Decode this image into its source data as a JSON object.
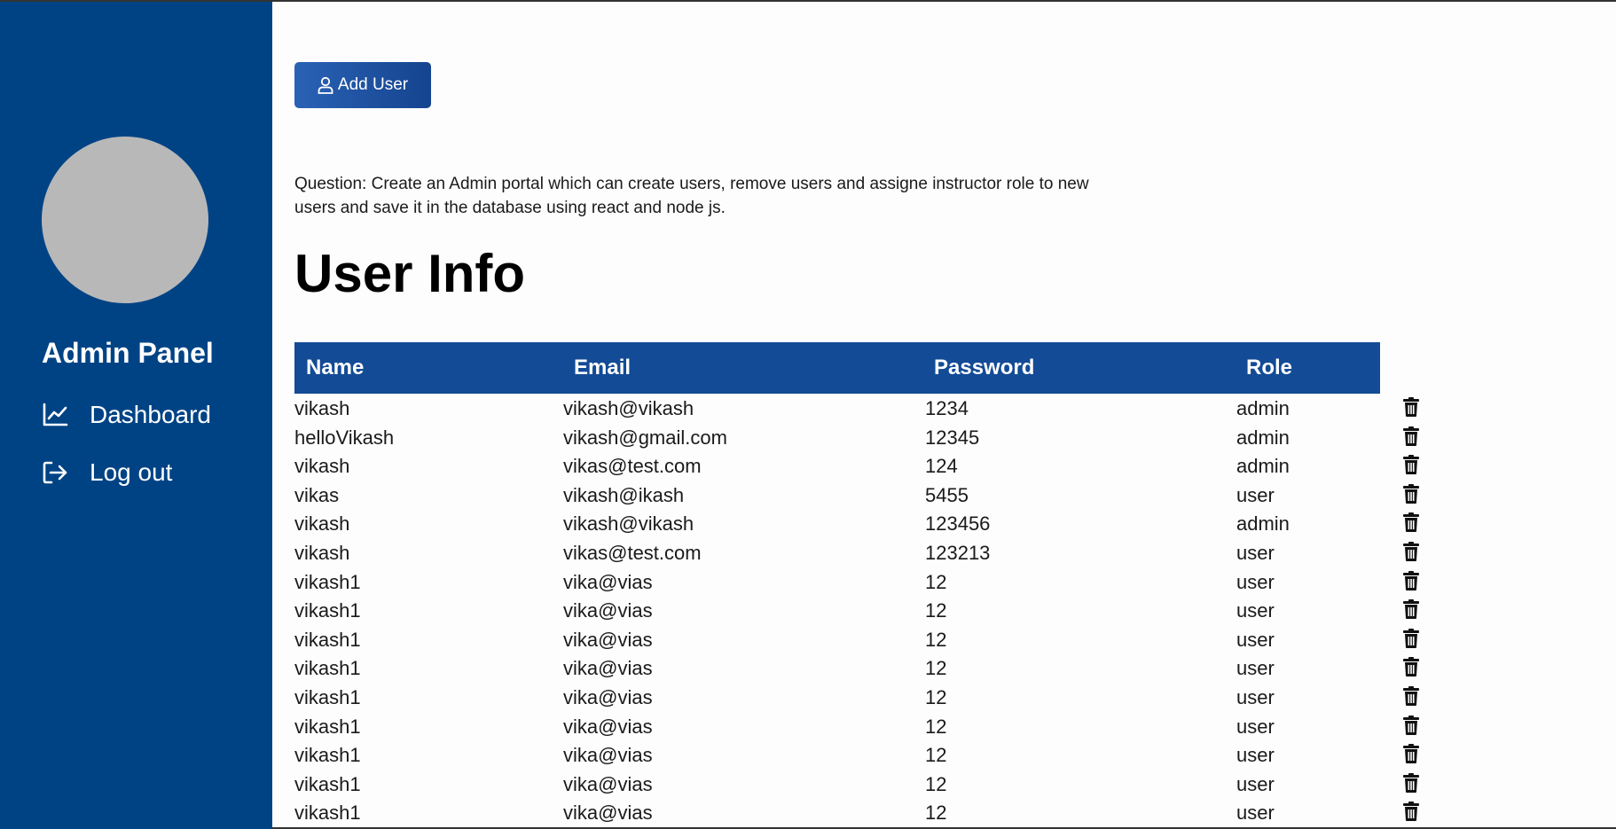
{
  "sidebar": {
    "title": "Admin Panel",
    "nav": [
      {
        "label": "Dashboard",
        "icon": "chart-line-icon"
      },
      {
        "label": "Log out",
        "icon": "logout-icon"
      }
    ],
    "background": "#004385"
  },
  "main": {
    "add_user_label": "Add User",
    "question": "Question: Create an Admin portal which can create users, remove users and assigne instructor role to new users and save it in the database using react and node js.",
    "title": "User Info",
    "table": {
      "columns": [
        "Name",
        "Email",
        "Password",
        "Role"
      ],
      "rows": [
        [
          "vikash",
          "vikash@vikash",
          "1234",
          "admin"
        ],
        [
          "helloVikash",
          "vikash@gmail.com",
          "12345",
          "admin"
        ],
        [
          "vikash",
          "vikas@test.com",
          "124",
          "admin"
        ],
        [
          "vikas",
          "vikash@ikash",
          "5455",
          "user"
        ],
        [
          "vikash",
          "vikash@vikash",
          "123456",
          "admin"
        ],
        [
          "vikash",
          "vikas@test.com",
          "123213",
          "user"
        ],
        [
          "vikash1",
          "vika@vias",
          "12",
          "user"
        ],
        [
          "vikash1",
          "vika@vias",
          "12",
          "user"
        ],
        [
          "vikash1",
          "vika@vias",
          "12",
          "user"
        ],
        [
          "vikash1",
          "vika@vias",
          "12",
          "user"
        ],
        [
          "vikash1",
          "vika@vias",
          "12",
          "user"
        ],
        [
          "vikash1",
          "vika@vias",
          "12",
          "user"
        ],
        [
          "vikash1",
          "vika@vias",
          "12",
          "user"
        ],
        [
          "vikash1",
          "vika@vias",
          "12",
          "user"
        ],
        [
          "vikash1",
          "vika@vias",
          "12",
          "user"
        ]
      ],
      "header_color": "#134b96",
      "row_action_icon": "trash-icon"
    }
  }
}
